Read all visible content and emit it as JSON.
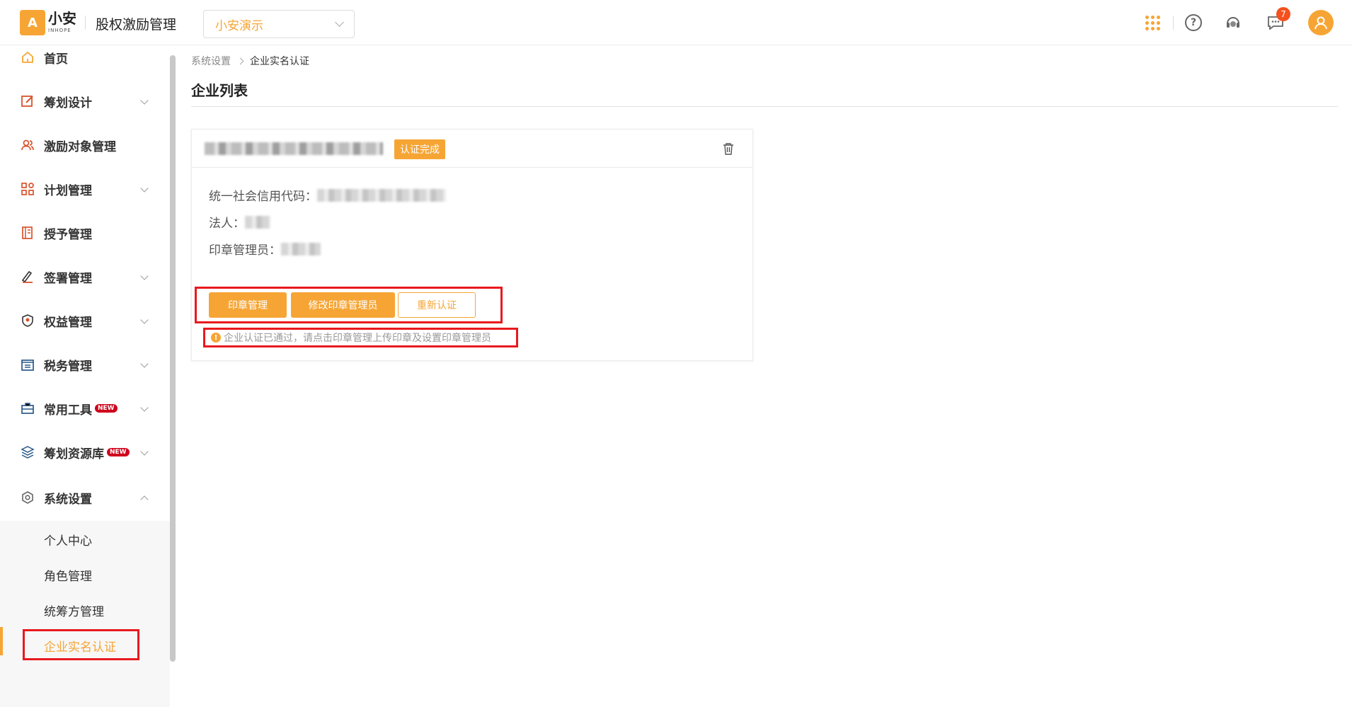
{
  "brand": {
    "logo_text": "小安",
    "logo_sub": "INHOPE",
    "app_title": "股权激励管理"
  },
  "org_select": {
    "value": "小安演示"
  },
  "topbar": {
    "notification_count": "7"
  },
  "sidebar": {
    "items": [
      {
        "label": "首页",
        "icon": "home-icon"
      },
      {
        "label": "筹划设计",
        "icon": "edit-icon"
      },
      {
        "label": "激励对象管理",
        "icon": "users-icon"
      },
      {
        "label": "计划管理",
        "icon": "apps-icon"
      },
      {
        "label": "授予管理",
        "icon": "book-icon"
      },
      {
        "label": "签署管理",
        "icon": "sign-icon"
      },
      {
        "label": "权益管理",
        "icon": "badge-icon"
      },
      {
        "label": "税务管理",
        "icon": "tax-icon"
      },
      {
        "label": "常用工具",
        "icon": "toolbox-icon",
        "badge": "NEW"
      },
      {
        "label": "筹划资源库",
        "icon": "layers-icon",
        "badge": "NEW"
      },
      {
        "label": "系统设置",
        "icon": "settings-icon"
      }
    ],
    "sub_items": [
      "个人中心",
      "角色管理",
      "统筹方管理",
      "企业实名认证"
    ]
  },
  "breadcrumb": {
    "parent": "系统设置",
    "current": "企业实名认证"
  },
  "page_title": "企业列表",
  "card": {
    "status": "认证完成",
    "credit_code_label": "统一社会信用代码：",
    "legal_person_label": "法人：",
    "seal_admin_label": "印章管理员：",
    "buttons": {
      "seal_manage": "印章管理",
      "edit_seal_admin": "修改印章管理员",
      "re_certify": "重新认证"
    },
    "tip": "企业认证已通过，请点击印章管理上传印章及设置印章管理员"
  },
  "colors": {
    "accent": "#f6a535",
    "highlight": "#e8191e"
  }
}
